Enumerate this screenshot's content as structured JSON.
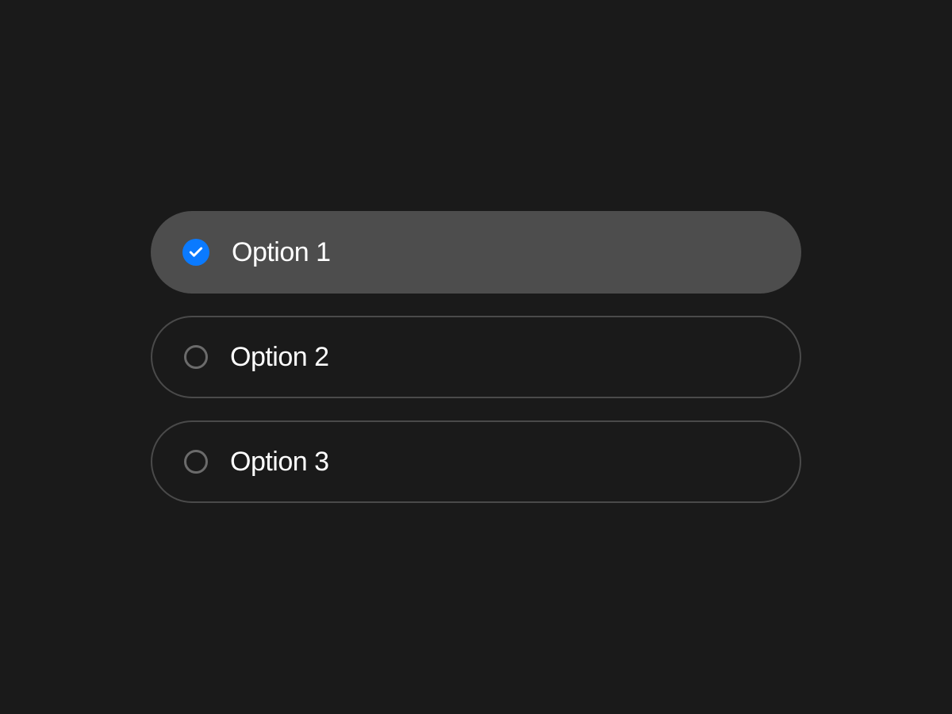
{
  "options": [
    {
      "label": "Option 1",
      "selected": true
    },
    {
      "label": "Option 2",
      "selected": false
    },
    {
      "label": "Option 3",
      "selected": false
    }
  ],
  "colors": {
    "background": "#1a1a1a",
    "selectedBackground": "#4d4d4d",
    "unselectedBorder": "#4a4a4a",
    "accentBlue": "#0a7aff",
    "text": "#ffffff",
    "radioBorder": "#6b6b6b"
  }
}
